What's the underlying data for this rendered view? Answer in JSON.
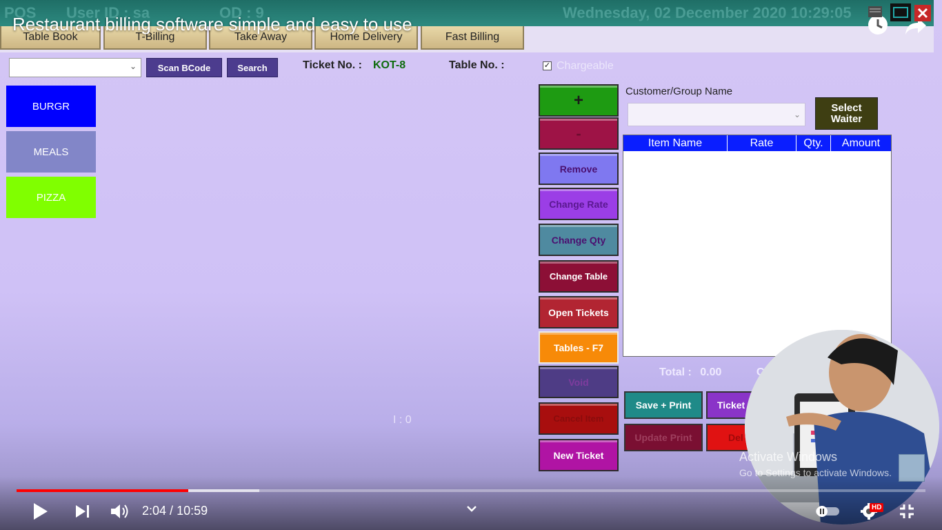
{
  "video": {
    "title": "Restaurant billing software simple and easy to use",
    "time_current": "2:04",
    "time_total": "10:59",
    "time_sep": " / ",
    "played_fraction": 0.189,
    "buffered_fraction": 0.267,
    "quality_badge": "HD"
  },
  "app": {
    "topbar": {
      "pos": "POS",
      "user": "User ID : sa",
      "od": "OD : 9",
      "datetime": "Wednesday, 02 December 2020 10:29:05"
    },
    "nav_tabs": [
      "Table Book",
      "T-Billing",
      "Take Away",
      "Home Delivery",
      "Fast Billing"
    ],
    "toolbar": {
      "scan_label": "Scan BCode",
      "search_label": "Search",
      "ticket_label": "Ticket No. :",
      "ticket_value": "KOT-8",
      "table_label": "Table No. :",
      "table_value": "",
      "chargeable_label": "Chargeable",
      "chargeable_checked": true
    },
    "categories": [
      {
        "label": "BURGR",
        "color": "#0000ff"
      },
      {
        "label": "MEALS",
        "color": "#8286c8"
      },
      {
        "label": "PIZZA",
        "color": "#80ff00"
      }
    ],
    "actions": [
      {
        "label": "+",
        "bg": "#1e9b12",
        "fg": "#1a1a1a"
      },
      {
        "label": "-",
        "bg": "#9e1346",
        "fg": "#6e0c30"
      },
      {
        "label": "Remove",
        "bg": "#7f78f0",
        "fg": "#4b1070"
      },
      {
        "label": "Change Rate",
        "bg": "#9b3ee6",
        "fg": "#5a1890"
      },
      {
        "label": "Change Qty",
        "bg": "#4f8aa0",
        "fg": "#4b1070"
      },
      {
        "label": "Change Table",
        "bg": "#8c0f36",
        "fg": "#ffffff"
      },
      {
        "label": "Open Tickets",
        "bg": "#b22532",
        "fg": "#ffffff"
      },
      {
        "label": "Tables - F7",
        "bg": "#f78a08",
        "fg": "#ffffff"
      },
      {
        "label": "Void",
        "bg": "#4e3c85",
        "fg": "#7e3c9e"
      },
      {
        "label": "Cancel Item",
        "bg": "#a80e0e",
        "fg": "#8a0c0c"
      },
      {
        "label": "New Ticket",
        "bg": "#b014a4",
        "fg": "#ffffff"
      }
    ],
    "customer": {
      "label": "Customer/Group Name",
      "waiter_label_1": "Select",
      "waiter_label_2": "Waiter"
    },
    "grid_columns": [
      "Item Name",
      "Rate",
      "Qty.",
      "Amount"
    ],
    "total_label": "Total :",
    "total_value": "0.00",
    "total_trailing": "C",
    "bottom_buttons": [
      {
        "label": "Save + Print",
        "bg": "#1f8a88",
        "fg": "#ffffff"
      },
      {
        "label": "Ticket",
        "bg": "#8a34c8",
        "fg": "#ffffff"
      },
      {
        "label": "Update Print",
        "bg": "#7a0f32",
        "fg": "#9e3f5e"
      },
      {
        "label": "Del",
        "bg": "#e01212",
        "fg": "#a00a0a"
      }
    ],
    "items_indicator": "I :   0",
    "activate_line1": "Activate Windows",
    "activate_line2": "Go to Settings to activate Windows."
  }
}
